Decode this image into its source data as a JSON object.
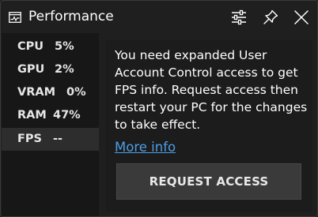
{
  "window": {
    "title": "Performance"
  },
  "titlebar_icons": [
    "performance-monitor-icon",
    "settings-sliders-icon",
    "pin-icon",
    "close-icon"
  ],
  "metrics": [
    {
      "label": "CPU",
      "value": "5%"
    },
    {
      "label": "GPU",
      "value": "2%"
    },
    {
      "label": "VRAM",
      "value": "0%"
    },
    {
      "label": "RAM",
      "value": "47%"
    },
    {
      "label": "FPS",
      "value": "--",
      "selected": true
    }
  ],
  "content": {
    "message": "You need expanded User Account Control access to get FPS info. Request access then restart your PC for the changes to take effect.",
    "more_info_link": "More info",
    "request_button": "REQUEST ACCESS"
  },
  "colors": {
    "background": "#1f1f1f",
    "sidebar": "#171717",
    "selected_item": "#2d2d2d",
    "link": "#4c9ee8",
    "button": "#3a3a3a"
  }
}
